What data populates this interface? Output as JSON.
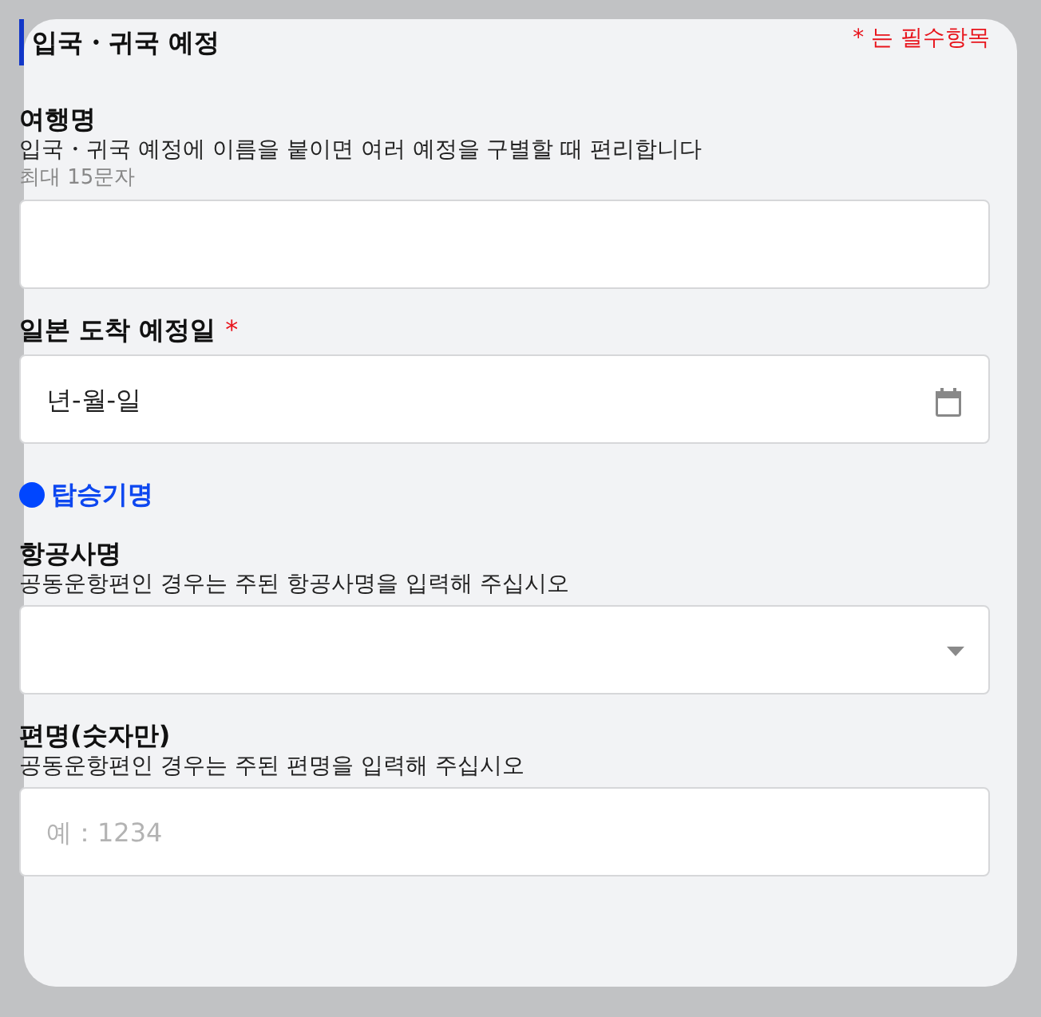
{
  "header": {
    "title": "입국・귀국 예정",
    "required_note": "* 는 필수항목"
  },
  "items": [
    {
      "kind": "text_field",
      "label": "여행명",
      "help": "입국・귀국 예정에 이름을 붙이면 여러 예정을 구별할 때 편리합니다",
      "note": "최대 15문자"
    },
    {
      "kind": "date_field",
      "label": "일본 도착 예정일",
      "required_mark": "*",
      "placeholder": "년-월-일"
    },
    {
      "kind": "subheading",
      "label": "탑승기명"
    },
    {
      "kind": "select_field",
      "label": "항공사명",
      "help": "공동운항편인 경우는 주된 항공사명을 입력해 주십시오"
    },
    {
      "kind": "text_field",
      "label": "편명(숫자만)",
      "help": "공동운항편인 경우는 주된 편명을 입력해 주십시오",
      "placeholder": "예：1234"
    }
  ]
}
